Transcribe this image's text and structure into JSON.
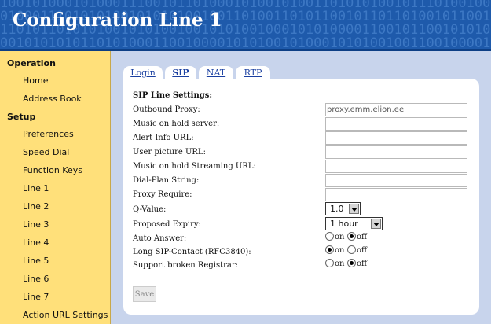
{
  "header": {
    "title": "Configuration Line 1",
    "binary_rows": [
      "10010100010100011100101101000101001010011010101001011101001000111010100101",
      "01000111010101001010101001001101001101011001011011010010110011110101001001",
      "11010110101010010101001001010100100010101000011001011001010101001011010010",
      "00101010101101010001100100001010100101000101010010011001000011010100101010",
      "10101000010101010010101010101001010010100101011000100101010101000101100101"
    ]
  },
  "sidebar": {
    "sections": [
      {
        "label": "Operation"
      },
      {
        "label": "Setup"
      }
    ],
    "items": [
      {
        "label": "Home"
      },
      {
        "label": "Address Book"
      },
      {
        "label": "Preferences"
      },
      {
        "label": "Speed Dial"
      },
      {
        "label": "Function Keys"
      },
      {
        "label": "Line 1"
      },
      {
        "label": "Line 2"
      },
      {
        "label": "Line 3"
      },
      {
        "label": "Line 4"
      },
      {
        "label": "Line 5"
      },
      {
        "label": "Line 6"
      },
      {
        "label": "Line 7"
      },
      {
        "label": "Action URL Settings"
      }
    ]
  },
  "tabs": [
    {
      "label": "Login"
    },
    {
      "label": "SIP",
      "active": true
    },
    {
      "label": "NAT"
    },
    {
      "label": "RTP"
    }
  ],
  "form": {
    "section_title": "SIP Line Settings:",
    "fields": [
      {
        "label": "Outbound Proxy:",
        "value": "proxy.emm.elion.ee"
      },
      {
        "label": "Music on hold server:",
        "value": ""
      },
      {
        "label": "Alert Info URL:",
        "value": ""
      },
      {
        "label": "User picture URL:",
        "value": ""
      },
      {
        "label": "Music on hold Streaming URL:",
        "value": ""
      },
      {
        "label": "Dial-Plan String:",
        "value": ""
      },
      {
        "label": "Proxy Require:",
        "value": ""
      }
    ],
    "selects": [
      {
        "label": "Q-Value:",
        "value": "1.0"
      },
      {
        "label": "Proposed Expiry:",
        "value": "1 hour"
      }
    ],
    "radios": [
      {
        "label": "Auto Answer:",
        "on_label": "on",
        "off_label": "off",
        "selected": "off"
      },
      {
        "label": "Long SIP-Contact (RFC3840):",
        "on_label": "on",
        "off_label": "off",
        "selected": "on"
      },
      {
        "label": "Support broken Registrar:",
        "on_label": "on",
        "off_label": "off",
        "selected": "off"
      }
    ],
    "save_label": "Save"
  }
}
